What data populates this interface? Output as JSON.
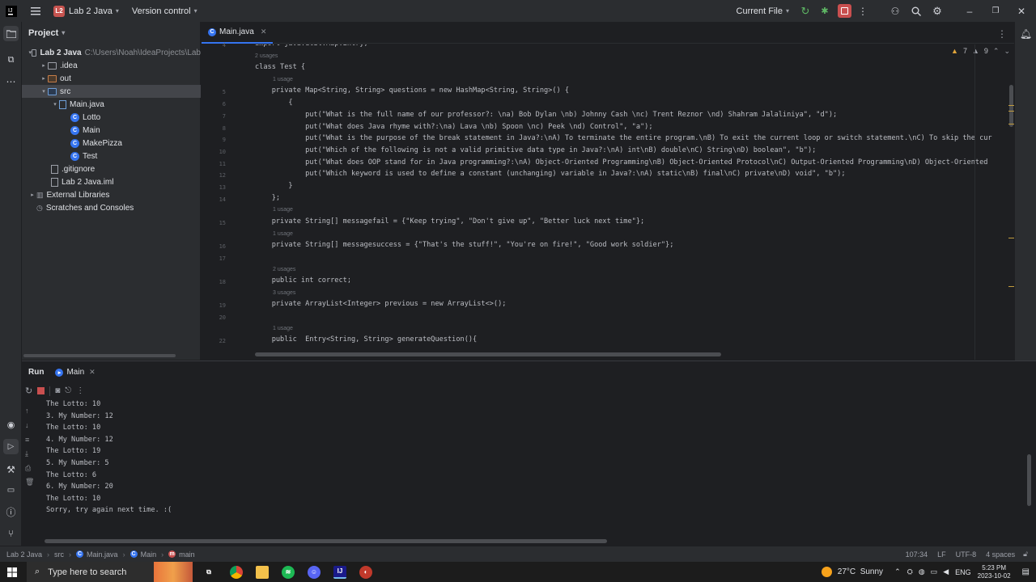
{
  "titlebar": {
    "project_name": "Lab 2 Java",
    "project_badge": "L2",
    "vcs": "Version control",
    "run_config": "Current File"
  },
  "project_panel": {
    "title": "Project",
    "tree": [
      {
        "label": "Lab 2 Java",
        "path": "C:\\Users\\Noah\\IdeaProjects\\Lab",
        "kind": "root"
      },
      {
        "label": ".idea",
        "kind": "folder"
      },
      {
        "label": "out",
        "kind": "folder-orange"
      },
      {
        "label": "src",
        "kind": "folder-blue"
      },
      {
        "label": "Main.java",
        "kind": "file-group"
      },
      {
        "label": "Lotto",
        "kind": "class"
      },
      {
        "label": "Main",
        "kind": "class"
      },
      {
        "label": "MakePizza",
        "kind": "class"
      },
      {
        "label": "Test",
        "kind": "class"
      },
      {
        "label": ".gitignore",
        "kind": "file"
      },
      {
        "label": "Lab 2 Java.iml",
        "kind": "file"
      },
      {
        "label": "External Libraries",
        "kind": "libs"
      },
      {
        "label": "Scratches and Consoles",
        "kind": "scratch"
      }
    ]
  },
  "editor": {
    "tab_label": "Main.java",
    "inspections": {
      "warnings": "7",
      "weak_warnings": "9"
    },
    "lines": [
      {
        "n": "4",
        "text": "import java.util.Map.Entry;"
      },
      {
        "hint": "2 usages"
      },
      {
        "n": "",
        "text": "class Test {"
      },
      {
        "hint": "1 usage"
      },
      {
        "n": "5",
        "text": "    private Map<String, String> questions = new HashMap<String, String>() {"
      },
      {
        "n": "6",
        "text": "        {"
      },
      {
        "n": "7",
        "text": "            put(\"What is the full name of our professor?: \\na) Bob Dylan \\nb) Johnny Cash \\nc) Trent Reznor \\nd) Shahram Jalaliniya\", \"d\");"
      },
      {
        "n": "8",
        "text": "            put(\"What does Java rhyme with?:\\na) Lava \\nb) Spoon \\nc) Peek \\nd) Control\", \"a\");"
      },
      {
        "n": "9",
        "text": "            put(\"What is the purpose of the break statement in Java?:\\nA) To terminate the entire program.\\nB) To exit the current loop or switch statement.\\nC) To skip the cur"
      },
      {
        "n": "10",
        "text": "            put(\"Which of the following is not a valid primitive data type in Java?:\\nA) int\\nB) double\\nC) String\\nD) boolean\", \"b\");"
      },
      {
        "n": "11",
        "text": "            put(\"What does OOP stand for in Java programming?:\\nA) Object-Oriented Programming\\nB) Object-Oriented Protocol\\nC) Output-Oriented Programming\\nD) Object-Oriented"
      },
      {
        "n": "12",
        "text": "            put(\"Which keyword is used to define a constant (unchanging) variable in Java?:\\nA) static\\nB) final\\nC) private\\nD) void\", \"b\");"
      },
      {
        "n": "13",
        "text": "        }"
      },
      {
        "n": "14",
        "text": "    };"
      },
      {
        "hint": "1 usage"
      },
      {
        "n": "15",
        "text": "    private String[] messagefail = {\"Keep trying\", \"Don't give up\", \"Better luck next time\"};"
      },
      {
        "hint": "1 usage"
      },
      {
        "n": "16",
        "text": "    private String[] messagesuccess = {\"That's the stuff!\", \"You're on fire!\", \"Good work soldier\"};"
      },
      {
        "n": "17",
        "text": ""
      },
      {
        "hint": "2 usages"
      },
      {
        "n": "18",
        "text": "    public int correct;"
      },
      {
        "hint": "3 usages"
      },
      {
        "n": "19",
        "text": "    private ArrayList<Integer> previous = new ArrayList<>();"
      },
      {
        "n": "20",
        "text": ""
      },
      {
        "hint": "1 usage"
      },
      {
        "n": "22",
        "text": "    public  Entry<String, String> generateQuestion(){"
      }
    ]
  },
  "run_panel": {
    "tab_run": "Run",
    "tab_main": "Main",
    "output": [
      "The Lotto: 10",
      "3. My Number: 12",
      "The Lotto: 10",
      "4. My Number: 12",
      "The Lotto: 19",
      "5. My Number: 5",
      "The Lotto: 6",
      "6. My Number: 20",
      "The Lotto: 10",
      "Sorry, try again next time. :("
    ]
  },
  "statusbar": {
    "crumbs": [
      "Lab 2 Java",
      "src",
      "Main.java",
      "Main",
      "main"
    ],
    "position": "107:34",
    "line_sep": "LF",
    "encoding": "UTF-8",
    "indent": "4 spaces"
  },
  "taskbar": {
    "search_placeholder": "Type here to search",
    "weather": "27°C  Sunny",
    "lang": "ENG",
    "time": "5:23 PM",
    "date": "2023-10-02"
  },
  "colors": {
    "accent": "#3574f0",
    "record": "#c94f4f",
    "warning": "#e0a43a"
  }
}
